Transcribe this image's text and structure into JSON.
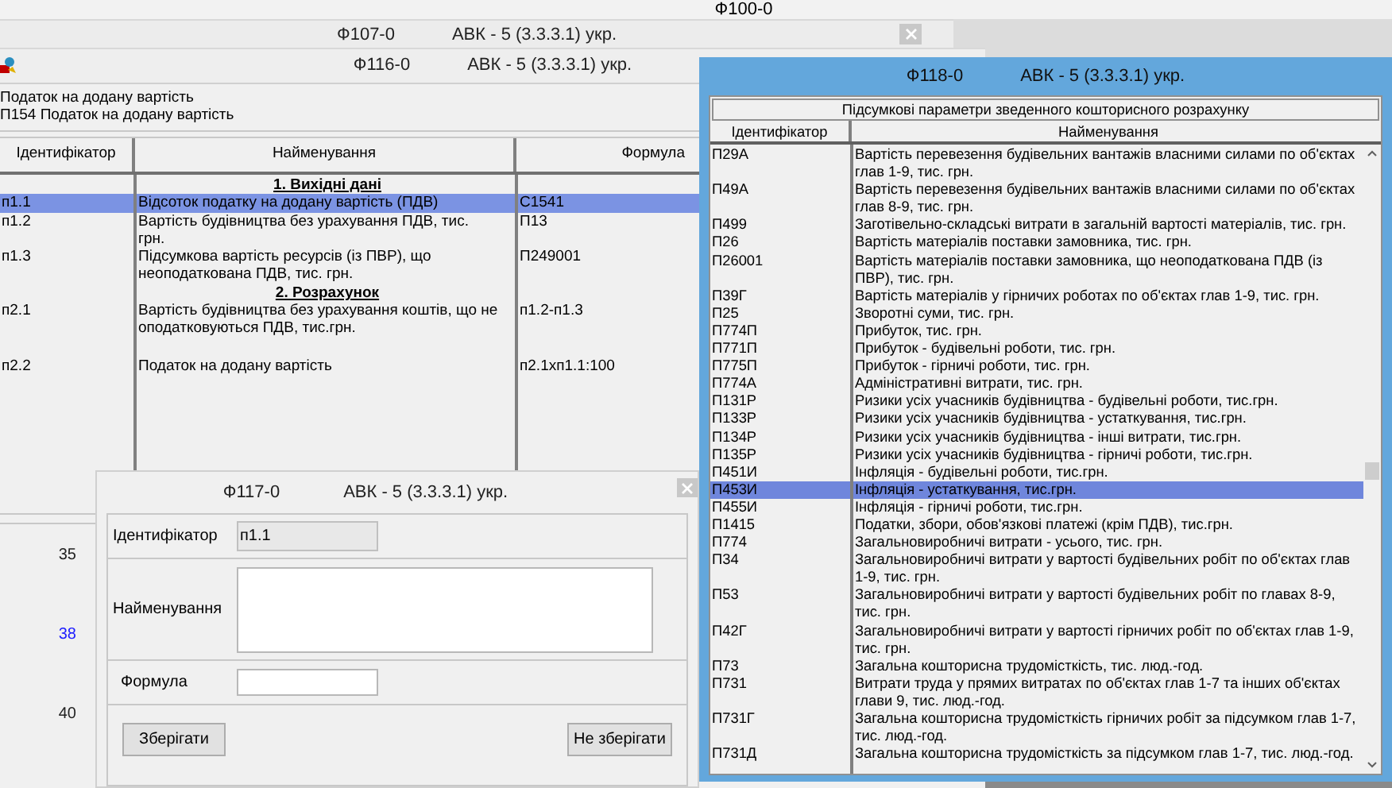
{
  "background_windows": [
    {
      "title": "Ф100-0"
    },
    {
      "title": "Ф107-0",
      "app": "АВК - 5 (3.3.3.1) укр."
    }
  ],
  "main_window": {
    "title": "Ф116-0",
    "app": "АВК - 5 (3.3.3.1) укр.",
    "header_lines": [
      "Податок на додану вартість",
      "П154 Податок на додану вартість"
    ],
    "table": {
      "columns": [
        "Ідентифікатор",
        "Найменування",
        "Формула"
      ],
      "rows": [
        {
          "kind": "section",
          "text": "1. Вихідні дані"
        },
        {
          "kind": "row",
          "cells": [
            "п1.1",
            "Відсоток податку на додану вартість (ПДВ)",
            "С1541"
          ],
          "selected": true
        },
        {
          "kind": "row",
          "cells": [
            "п1.2",
            "Вартість будівництва без  урахування ПДВ, тис. грн.",
            "П13"
          ],
          "selected": false
        },
        {
          "kind": "row",
          "cells": [
            "п1.3",
            "Підсумкова вартість ресурсів (із ПВР), що неоподаткована  ПДВ, тис. грн.",
            "П249001"
          ],
          "selected": false
        },
        {
          "kind": "section",
          "text": "2. Розрахунок"
        },
        {
          "kind": "row",
          "cells": [
            "п2.1",
            "Вартість будівництва без урахування коштів, що не оподатковуються ПДВ,  тис.грн.",
            "п1.2-п1.3"
          ],
          "selected": false
        },
        {
          "kind": "row",
          "cells": [
            "п2.2",
            "Податок на додану вартість",
            "п2.1хп1.1:100"
          ],
          "selected": false
        }
      ]
    },
    "side_numbers": [
      {
        "text": "35",
        "highlighted": false
      },
      {
        "text": "38",
        "highlighted": true
      },
      {
        "text": "40",
        "highlighted": false
      }
    ]
  },
  "dialog": {
    "title": "Ф117-0",
    "app": "АВК - 5 (3.3.3.1) укр.",
    "fields": [
      {
        "label": "Ідентифікатор",
        "value": "п1.1",
        "kind": "readonly"
      },
      {
        "label": "Найменування",
        "kind": "multiline"
      },
      {
        "label": "Формула",
        "kind": "text"
      }
    ],
    "buttons": [
      "Зберігати",
      "Не зберігати"
    ]
  },
  "summary_window": {
    "title": "Ф118-0",
    "app": "АВК - 5 (3.3.3.1) укр.",
    "caption": "Підсумкові параметри зведенного кошторисного розрахунку",
    "columns": [
      "Ідентифікатор",
      "Найменування"
    ],
    "rows": [
      {
        "id": "П29А",
        "name": "Вартість перевезення будівельних вантажів власними силами по об'єктах глав 1-9, тис. грн.",
        "selected": false
      },
      {
        "id": "П49А",
        "name": "Вартість перевезення будівельних вантажів власними силами по об'єктах глав 8-9, тис. грн.",
        "selected": false
      },
      {
        "id": "П499",
        "name": "Заготівельно-складські витрати в загальній вартості матеріалів, тис. грн.",
        "selected": false
      },
      {
        "id": "П26",
        "name": "Вартість матеріалів поставки замовника, тис. грн.",
        "selected": false
      },
      {
        "id": "П26001",
        "name": "Вартість матеріалів поставки замовника, що неоподаткована ПДВ (із ПВР), тис. грн.",
        "selected": false
      },
      {
        "id": "П39Г",
        "name": "Вартість матеріалів у гірничих роботах по об'єктах глав 1-9, тис. грн.",
        "selected": false
      },
      {
        "id": "П25",
        "name": "Зворотні суми, тис. грн.",
        "selected": false
      },
      {
        "id": "П774П",
        "name": "Прибуток, тис. грн.",
        "selected": false
      },
      {
        "id": "П771П",
        "name": "Прибуток - будівельні роботи, тис. грн.",
        "selected": false
      },
      {
        "id": "П775П",
        "name": "Прибуток - гірничі роботи, тис. грн.",
        "selected": false
      },
      {
        "id": "П774А",
        "name": "Адміністративні витрати, тис. грн.",
        "selected": false
      },
      {
        "id": "П131Р",
        "name": "Ризики усіх учасників будівництва - будівельні роботи, тис.грн.",
        "selected": false
      },
      {
        "id": "П133Р",
        "name": "Ризики усіх учасників будівництва - устаткування, тис.грн.",
        "selected": false
      },
      {
        "id": "П134Р",
        "name": "Ризики усіх учасників будівництва - інші витрати, тис.грн.",
        "selected": false
      },
      {
        "id": "П135Р",
        "name": "Ризики усіх учасників будівництва - гірничі роботи, тис.грн.",
        "selected": false
      },
      {
        "id": "П451И",
        "name": "Інфляція - будівельні роботи, тис.грн.",
        "selected": false
      },
      {
        "id": "П453И",
        "name": "Інфляція - устаткування, тис.грн.",
        "selected": true
      },
      {
        "id": "П455И",
        "name": "Інфляція - гірничі роботи, тис.грн.",
        "selected": false
      },
      {
        "id": "П1415",
        "name": "Податки, збори, обов'язкові платежі (крім ПДВ), тис.грн.",
        "selected": false
      },
      {
        "id": "П774",
        "name": "Загальновиробничі витрати - усього, тис. грн.",
        "selected": false
      },
      {
        "id": "П34",
        "name": "Загальновиробничі витрати у вартості  будівельних  робіт по об'єктах глав 1-9, тис. грн.",
        "selected": false
      },
      {
        "id": "П53",
        "name": "Загальновиробничі витрати у вартості  будівельних робіт по главах 8-9, тис. грн.",
        "selected": false
      },
      {
        "id": "П42Г",
        "name": "Загальновиробничі витрати у вартості гірничих робіт по об'єктах глав 1-9, тис. грн.",
        "selected": false
      },
      {
        "id": "П73",
        "name": "Загальна кошторисна трудомісткість, тис. люд.-год.",
        "selected": false
      },
      {
        "id": "П731",
        "name": "Витрати труда у прямих витратах по об'єктах глав 1-7 та інших об'єктах глави 9, тис. люд.-год.",
        "selected": false
      },
      {
        "id": "П731Г",
        "name": "Загальна кошторисна трудомісткість гірничих робіт за  підсумком глав 1-7, тис. люд.-год.",
        "selected": false
      },
      {
        "id": "П731Д",
        "name": "Загальна кошторисна трудомісткість за  підсумком глав 1-7, тис. люд.-год.",
        "selected": false
      }
    ]
  }
}
